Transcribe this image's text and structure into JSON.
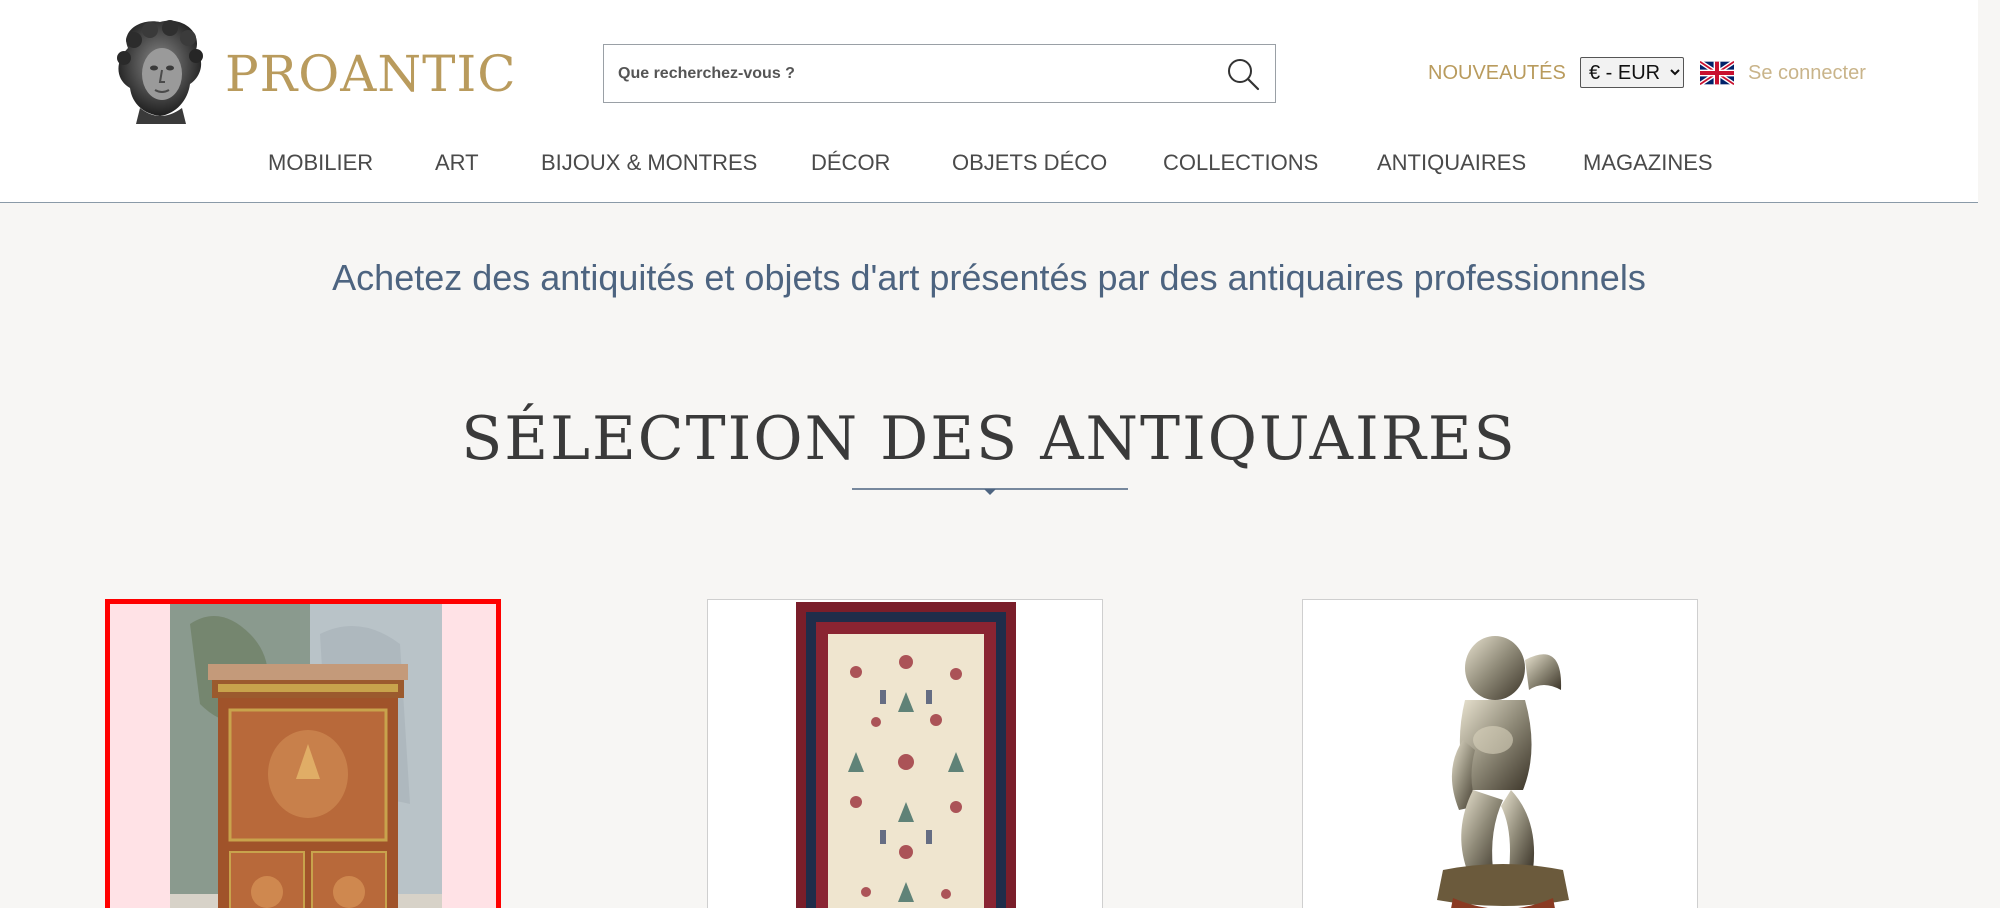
{
  "header": {
    "logo_text": "PROANTIC",
    "search_placeholder": "Que recherchez-vous ?",
    "new_link": "NOUVEAUTÉS",
    "currency": {
      "selected": "€ - EUR",
      "options": [
        "€ - EUR"
      ]
    },
    "language_flag": "uk-flag-icon",
    "login_link": "Se connecter"
  },
  "nav": {
    "items": [
      {
        "label": "MOBILIER"
      },
      {
        "label": "ART"
      },
      {
        "label": "BIJOUX & MONTRES"
      },
      {
        "label": "DÉCOR"
      },
      {
        "label": "OBJETS DÉCO"
      },
      {
        "label": "COLLECTIONS"
      },
      {
        "label": "ANTIQUAIRES"
      },
      {
        "label": "MAGAZINES"
      }
    ]
  },
  "main": {
    "tagline": "Achetez des antiquités et objets d'art présentés par des antiquaires professionnels",
    "section_title": "SÉLECTION DES ANTIQUAIRES",
    "cards": [
      {
        "image": "secretary-cabinet-image",
        "selected": true
      },
      {
        "image": "oriental-rug-image",
        "selected": false
      },
      {
        "image": "silver-cherub-sculpture-image",
        "selected": false
      }
    ]
  },
  "colors": {
    "gold": "#b99b5d",
    "tagline_blue": "#4d6480",
    "selection_red": "#ff0000",
    "background": "#f7f6f4"
  }
}
